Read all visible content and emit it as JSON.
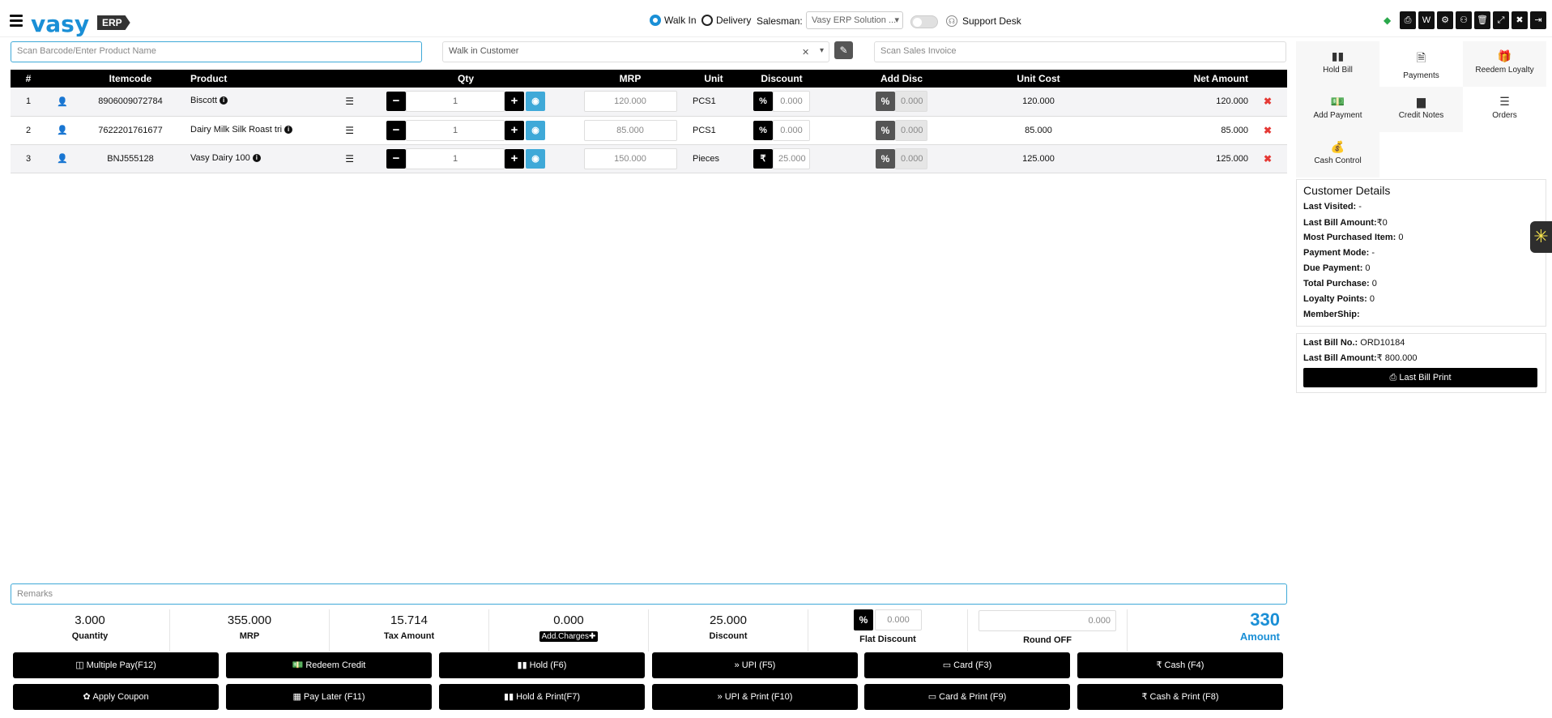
{
  "header": {
    "logo_text": "vasy",
    "logo_badge": "ERP",
    "order_type": {
      "walk_in": "Walk In",
      "delivery": "Delivery",
      "selected": "Walk In"
    },
    "salesman_label": "Salesman:",
    "salesman_value": "Vasy ERP Solution ...",
    "support_label": "Support Desk",
    "top_icons": [
      "print-icon",
      "whatsapp-icon",
      "settings-icon",
      "bicycle-icon",
      "trash-icon",
      "fullscreen-icon",
      "close-icon",
      "logout-icon"
    ],
    "top_icon_glyphs": [
      "⎙",
      "W",
      "⚙",
      "⚇",
      "🗑",
      "⤢",
      "✖",
      "⇥"
    ]
  },
  "search": {
    "product_placeholder": "Scan Barcode/Enter Product Name",
    "customer_value": "Walk in Customer",
    "invoice_placeholder": "Scan Sales Invoice"
  },
  "table": {
    "headers": [
      "#",
      "Itemcode",
      "Product",
      "Qty",
      "MRP",
      "Unit",
      "Discount",
      "Add Disc",
      "Unit Cost",
      "Net Amount"
    ],
    "rows": [
      {
        "n": "1",
        "code": "8906009072784",
        "product": "Biscott",
        "qty": "1",
        "mrp": "120.000",
        "unit": "PCS1",
        "disc_type": "%",
        "disc": "0.000",
        "add_disc": "0.000",
        "unit_cost": "120.000",
        "net": "120.000"
      },
      {
        "n": "2",
        "code": "7622201761677",
        "product": "Dairy Milk Silk Roast tri",
        "qty": "1",
        "mrp": "85.000",
        "unit": "PCS1",
        "disc_type": "%",
        "disc": "0.000",
        "add_disc": "0.000",
        "unit_cost": "85.000",
        "net": "85.000"
      },
      {
        "n": "3",
        "code": "BNJ555128",
        "product": "Vasy Dairy 100",
        "qty": "1",
        "mrp": "150.000",
        "unit": "Pieces",
        "disc_type": "₹",
        "disc": "25.000",
        "add_disc": "0.000",
        "unit_cost": "125.000",
        "net": "125.000"
      }
    ]
  },
  "quick_actions": [
    {
      "label": "Hold Bill",
      "icon": "pause-icon",
      "glyph": "▮▮"
    },
    {
      "label": "Payments",
      "icon": "document-icon",
      "glyph": "🗎"
    },
    {
      "label": "Reedem Loyalty",
      "icon": "gift-icon",
      "glyph": "🎁"
    },
    {
      "label": "Add Payment",
      "icon": "money-icon",
      "glyph": "💵"
    },
    {
      "label": "Credit Notes",
      "icon": "note-icon",
      "glyph": "▆"
    },
    {
      "label": "Orders",
      "icon": "list-icon",
      "glyph": "☰"
    },
    {
      "label": "Cash Control",
      "icon": "hand-money-icon",
      "glyph": "💰"
    }
  ],
  "customer_details": {
    "title": "Customer Details",
    "rows": [
      {
        "label": "Last Visited:",
        "value": " -"
      },
      {
        "label": "Last Bill Amount:",
        "value": "₹0"
      },
      {
        "label": "Most Purchased Item:",
        "value": " 0"
      },
      {
        "label": "Payment Mode:",
        "value": " -"
      },
      {
        "label": "Due Payment:",
        "value": " 0"
      },
      {
        "label": "Total Purchase:",
        "value": " 0"
      },
      {
        "label": "Loyalty Points:",
        "value": " 0"
      },
      {
        "label": "MemberShip:",
        "value": ""
      }
    ]
  },
  "last_bill": {
    "no_label": "Last Bill No.:",
    "no_value": " ORD10184",
    "amount_label": "Last Bill Amount:",
    "amount_value": "₹ 800.000",
    "print_label": "Last Bill Print"
  },
  "remarks_placeholder": "Remarks",
  "summary": {
    "quantity": {
      "value": "3.000",
      "label": "Quantity"
    },
    "mrp": {
      "value": "355.000",
      "label": "MRP"
    },
    "tax": {
      "value": "15.714",
      "label": "Tax Amount"
    },
    "charges": {
      "value": "0.000",
      "label": "Add.Charges"
    },
    "discount": {
      "value": "25.000",
      "label": "Discount"
    },
    "flat_discount": {
      "value": "0.000",
      "label": "Flat Discount",
      "type": "%"
    },
    "round_off": {
      "value": "0.000",
      "label": "Round OFF"
    },
    "amount": {
      "value": "330",
      "label": "Amount"
    }
  },
  "payment_buttons": [
    {
      "label": "Multiple Pay(F12)",
      "glyph": "◫"
    },
    {
      "label": "Redeem Credit",
      "glyph": "💵"
    },
    {
      "label": "Hold (F6)",
      "glyph": "▮▮"
    },
    {
      "label": "UPI (F5)",
      "glyph": "»"
    },
    {
      "label": "Card (F3)",
      "glyph": "▭"
    },
    {
      "label": "Cash (F4)",
      "glyph": "₹"
    },
    {
      "label": "Apply Coupon",
      "glyph": "✿"
    },
    {
      "label": "Pay Later (F11)",
      "glyph": "▦"
    },
    {
      "label": "Hold & Print(F7)",
      "glyph": "▮▮"
    },
    {
      "label": "UPI & Print (F10)",
      "glyph": "»"
    },
    {
      "label": "Card & Print (F9)",
      "glyph": "▭"
    },
    {
      "label": "Cash & Print (F8)",
      "glyph": "₹"
    }
  ]
}
